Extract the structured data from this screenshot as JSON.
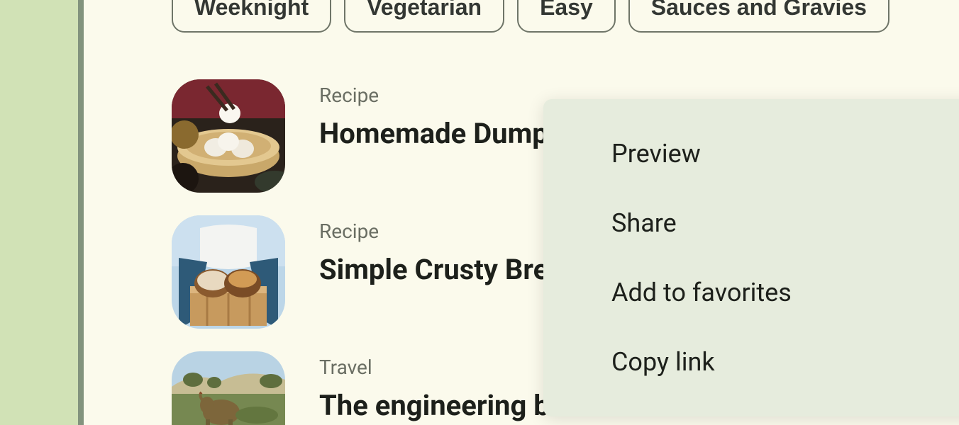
{
  "chips": [
    "Weeknight",
    "Vegetarian",
    "Easy",
    "Sauces and Gravies"
  ],
  "items": [
    {
      "category": "Recipe",
      "title": "Homemade Dumplings"
    },
    {
      "category": "Recipe",
      "title": "Simple Crusty Bread"
    },
    {
      "category": "Travel",
      "title": "The engineering brilliance of India's most famous trombs"
    }
  ],
  "menu": {
    "preview": "Preview",
    "share": "Share",
    "favorites": "Add to favorites",
    "copy": "Copy link"
  }
}
